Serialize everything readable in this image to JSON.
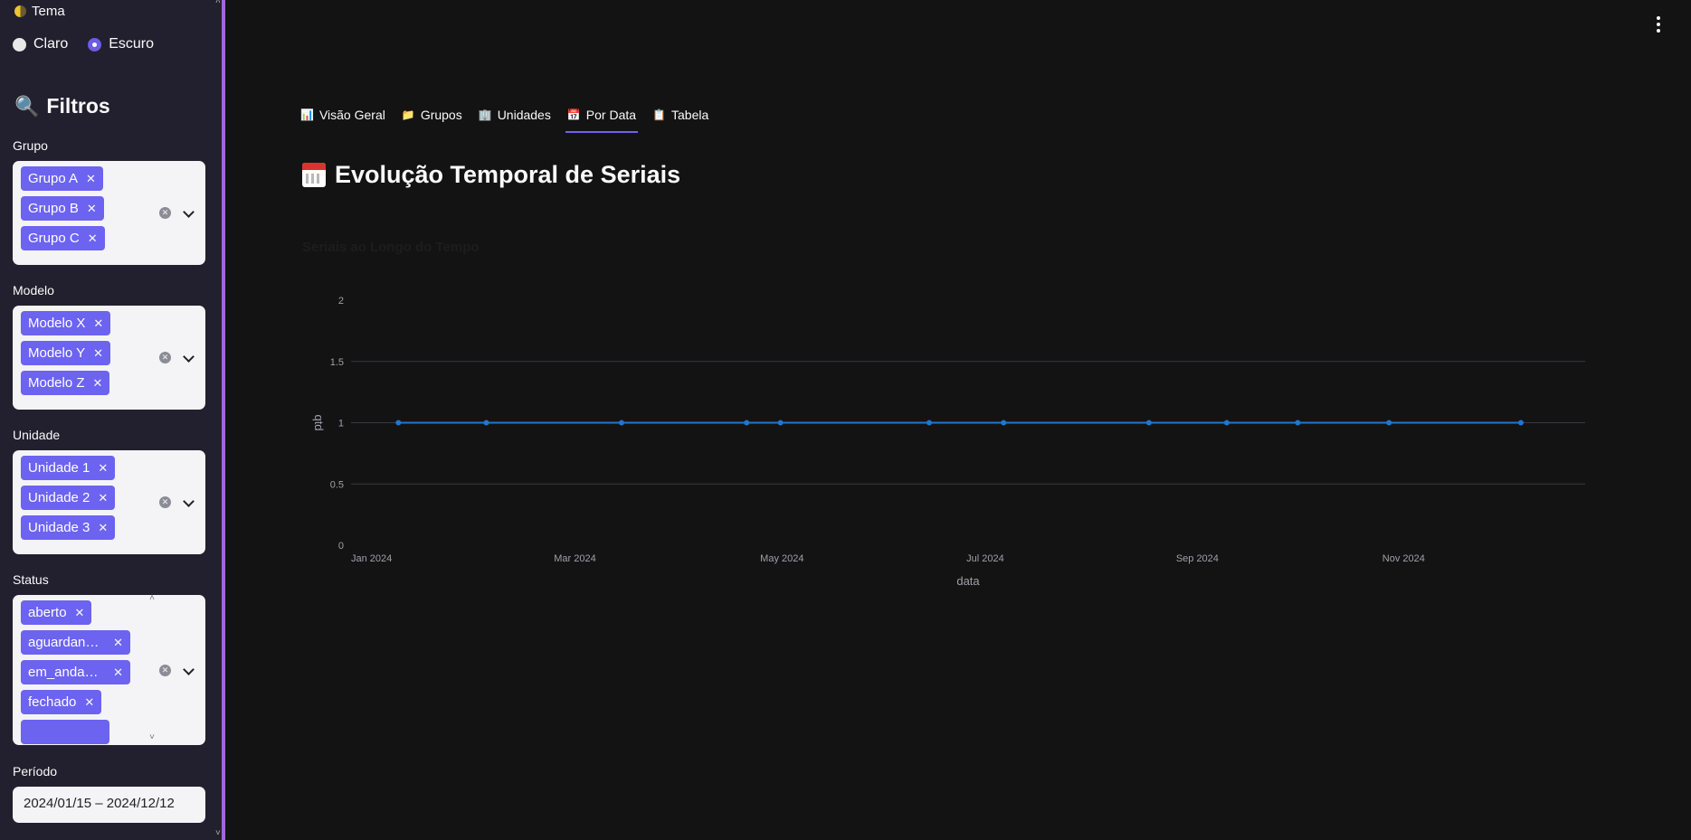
{
  "sidebar": {
    "theme_label": "Tema",
    "theme_options": [
      {
        "label": "Claro",
        "selected": false
      },
      {
        "label": "Escuro",
        "selected": true
      }
    ],
    "filters_title": "Filtros",
    "grupo": {
      "label": "Grupo",
      "chips": [
        "Grupo A",
        "Grupo B",
        "Grupo C"
      ]
    },
    "modelo": {
      "label": "Modelo",
      "chips": [
        "Modelo X",
        "Modelo Y",
        "Modelo Z"
      ]
    },
    "unidade": {
      "label": "Unidade",
      "chips": [
        "Unidade 1",
        "Unidade 2",
        "Unidade 3"
      ]
    },
    "status": {
      "label": "Status",
      "chips": [
        "aberto",
        "aguardan…",
        "em_anda…",
        "fechado"
      ]
    },
    "periodo": {
      "label": "Período",
      "value": "2024/01/15 – 2024/12/12"
    }
  },
  "tabs": [
    {
      "icon": "📊",
      "label": "Visão Geral",
      "active": false
    },
    {
      "icon": "📁",
      "label": "Grupos",
      "active": false
    },
    {
      "icon": "🏢",
      "label": "Unidades",
      "active": false
    },
    {
      "icon": "📅",
      "label": "Por Data",
      "active": true
    },
    {
      "icon": "📋",
      "label": "Tabela",
      "active": false
    }
  ],
  "page_title": "Evolução Temporal de Seriais",
  "chart_title": "Seriais ao Longo do Tempo",
  "colors": {
    "accent": "#6c63f0",
    "line": "#1f77d4",
    "sidebar_border": "#a066dc"
  },
  "chart_data": {
    "type": "line",
    "title": "Seriais ao Longo do Tempo",
    "xlabel": "data",
    "ylabel": "qtd",
    "x": [
      "2024-01-15",
      "2024-02-10",
      "2024-03-21",
      "2024-04-27",
      "2024-05-07",
      "2024-06-20",
      "2024-07-12",
      "2024-08-24",
      "2024-09-16",
      "2024-10-07",
      "2024-11-03",
      "2024-12-12"
    ],
    "y": [
      1,
      1,
      1,
      1,
      1,
      1,
      1,
      1,
      1,
      1,
      1,
      1
    ],
    "xlim": [
      "2024-01-01",
      "2024-12-31"
    ],
    "ylim": [
      0,
      2
    ],
    "yticks": [
      "0",
      "0.5",
      "1",
      "1.5",
      "2"
    ],
    "xticks": [
      {
        "date": "2024-01-01",
        "label": "Jan 2024"
      },
      {
        "date": "2024-03-01",
        "label": "Mar 2024"
      },
      {
        "date": "2024-05-01",
        "label": "May 2024"
      },
      {
        "date": "2024-07-01",
        "label": "Jul 2024"
      },
      {
        "date": "2024-09-01",
        "label": "Sep 2024"
      },
      {
        "date": "2024-11-01",
        "label": "Nov 2024"
      }
    ],
    "grid": true
  }
}
